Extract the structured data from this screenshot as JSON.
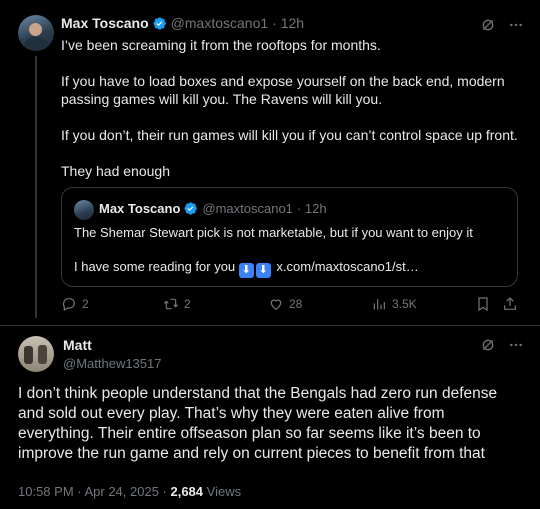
{
  "tweet": {
    "author_name": "Max Toscano",
    "author_handle": "@maxtoscano1",
    "time": "· 12h",
    "paragraphs": [
      "I’ve been screaming it from the rooftops for months.",
      "If you have to load boxes and expose yourself on the back end, modern passing games will kill you. The Ravens will kill you.",
      "If you don’t, their run games will kill you if you can’t control space up front.",
      "They had enough"
    ],
    "quote": {
      "author_name": "Max Toscano",
      "author_handle": "@maxtoscano1",
      "time": "· 12h",
      "line1": "The Shemar Stewart pick is not marketable, but if you want to enjoy it",
      "line2_prefix": "I have some reading for you",
      "line2_link": "x.com/maxtoscano1/st…"
    },
    "actions": {
      "replies": "2",
      "reposts": "2",
      "likes": "28",
      "views": "3.5K"
    }
  },
  "reply": {
    "author_name": "Matt",
    "author_handle": "@Matthew13517",
    "text": "I don’t think people understand that the Bengals had zero run defense and sold out every play. That’s why they were eaten alive from everything. Their entire offseason plan so far seems like it’s been to improve the run game and rely on current pieces to benefit from that",
    "timestamp": "10:58 PM · Apr 24, 2025 · ",
    "views_count": "2,684",
    "views_label": " Views"
  },
  "colors": {
    "background": "#000000",
    "text": "#e7e9ea",
    "muted": "#71767b",
    "verified": "#1d9bf0",
    "border": "#333639"
  }
}
